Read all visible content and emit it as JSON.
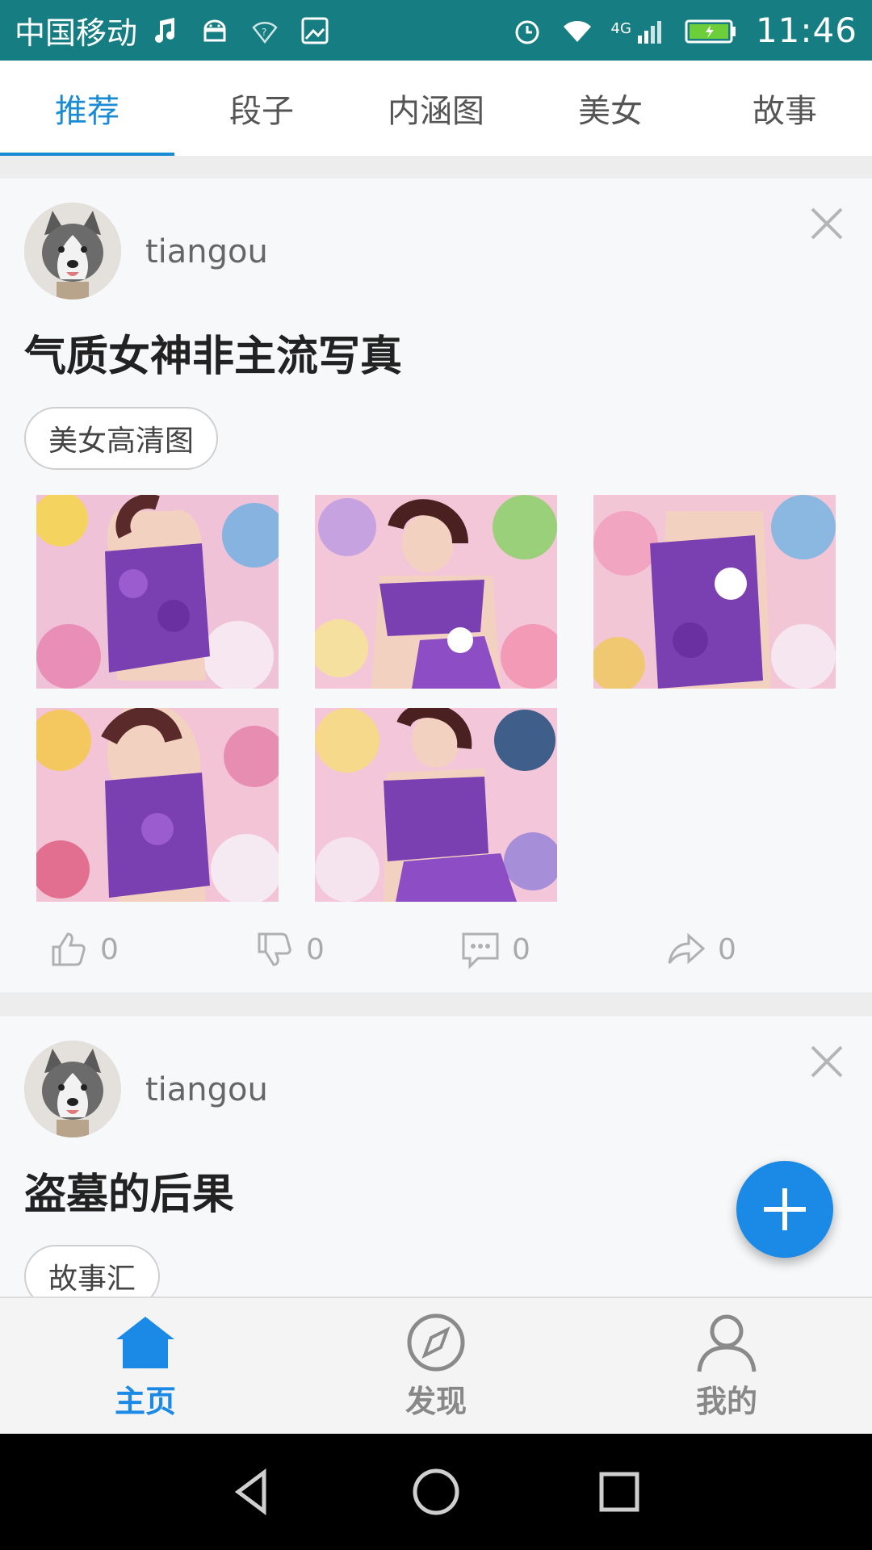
{
  "status_bar": {
    "carrier": "中国移动",
    "network": "4G",
    "time": "11:46"
  },
  "tabs": [
    {
      "label": "推荐",
      "active": true
    },
    {
      "label": "段子",
      "active": false
    },
    {
      "label": "内涵图",
      "active": false
    },
    {
      "label": "美女",
      "active": false
    },
    {
      "label": "故事",
      "active": false
    }
  ],
  "posts": [
    {
      "username": "tiangou",
      "title": "气质女神非主流写真",
      "tag": "美女高清图",
      "image_count": 5,
      "likes": "0",
      "dislikes": "0",
      "comments": "0",
      "shares": "0"
    },
    {
      "username": "tiangou",
      "title": "盗墓的后果",
      "tag": "故事汇"
    }
  ],
  "bottom_nav": [
    {
      "label": "主页",
      "icon": "home-icon",
      "active": true
    },
    {
      "label": "发现",
      "icon": "compass-icon",
      "active": false
    },
    {
      "label": "我的",
      "icon": "user-icon",
      "active": false
    }
  ],
  "colors": {
    "status_bar": "#167e82",
    "accent": "#1a8ad4",
    "fab": "#1a8ae6"
  }
}
